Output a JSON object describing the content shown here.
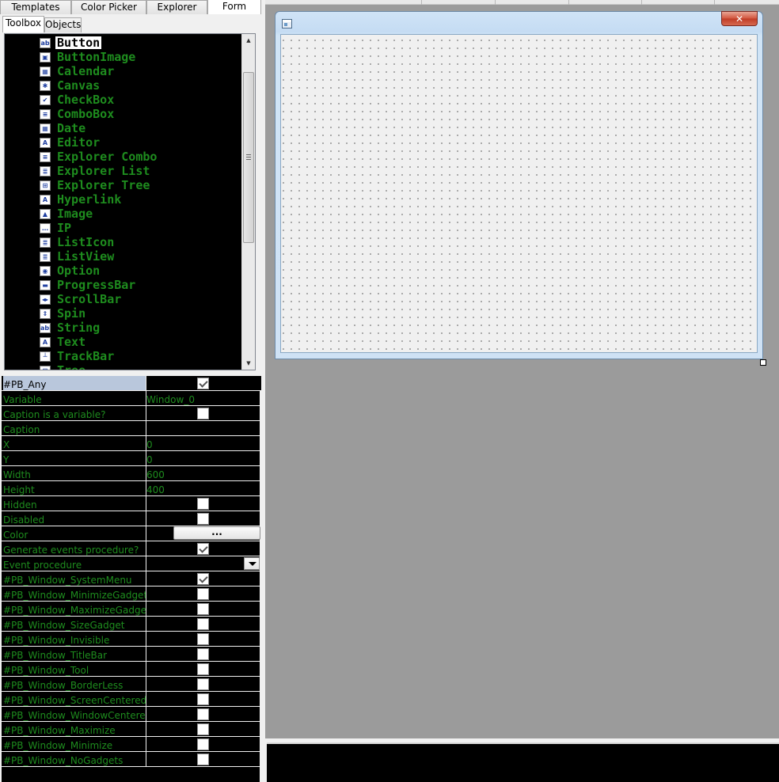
{
  "top_tabs": [
    {
      "label": "Templates",
      "active": false
    },
    {
      "label": "Color Picker",
      "active": false
    },
    {
      "label": "Explorer",
      "active": false
    },
    {
      "label": "Form",
      "active": true
    }
  ],
  "sub_tabs": [
    {
      "label": "Toolbox",
      "active": true
    },
    {
      "label": "Objects",
      "active": false
    }
  ],
  "toolbox": {
    "items": [
      {
        "label": "Button",
        "icon": "button-icon",
        "glyph": "ab",
        "selected": true
      },
      {
        "label": "ButtonImage",
        "icon": "button-image-icon",
        "glyph": "▣"
      },
      {
        "label": "Calendar",
        "icon": "calendar-icon",
        "glyph": "▦"
      },
      {
        "label": "Canvas",
        "icon": "canvas-icon",
        "glyph": "✱"
      },
      {
        "label": "CheckBox",
        "icon": "checkbox-icon",
        "glyph": "✔"
      },
      {
        "label": "ComboBox",
        "icon": "combobox-icon",
        "glyph": "≡"
      },
      {
        "label": "Date",
        "icon": "date-icon",
        "glyph": "▦"
      },
      {
        "label": "Editor",
        "icon": "editor-icon",
        "glyph": "A"
      },
      {
        "label": "Explorer Combo",
        "icon": "explorer-combo-icon",
        "glyph": "≡"
      },
      {
        "label": "Explorer List",
        "icon": "explorer-list-icon",
        "glyph": "≣"
      },
      {
        "label": "Explorer Tree",
        "icon": "explorer-tree-icon",
        "glyph": "⊞"
      },
      {
        "label": "Hyperlink",
        "icon": "hyperlink-icon",
        "glyph": "A"
      },
      {
        "label": "Image",
        "icon": "image-icon",
        "glyph": "▲"
      },
      {
        "label": "IP",
        "icon": "ip-icon",
        "glyph": "…"
      },
      {
        "label": "ListIcon",
        "icon": "list-icon-icon",
        "glyph": "≣"
      },
      {
        "label": "ListView",
        "icon": "listview-icon",
        "glyph": "≣"
      },
      {
        "label": "Option",
        "icon": "option-icon",
        "glyph": "◉"
      },
      {
        "label": "ProgressBar",
        "icon": "progressbar-icon",
        "glyph": "▬"
      },
      {
        "label": "ScrollBar",
        "icon": "scrollbar-icon",
        "glyph": "◂▸"
      },
      {
        "label": "Spin",
        "icon": "spin-icon",
        "glyph": "⇕"
      },
      {
        "label": "String",
        "icon": "string-icon",
        "glyph": "abl"
      },
      {
        "label": "Text",
        "icon": "text-icon",
        "glyph": "A"
      },
      {
        "label": "TrackBar",
        "icon": "trackbar-icon",
        "glyph": "┴"
      },
      {
        "label": "Tree",
        "icon": "tree-icon",
        "glyph": "⊞"
      }
    ]
  },
  "properties": [
    {
      "name": "#PB_Any",
      "type": "check",
      "checked": true,
      "header": true
    },
    {
      "name": "Variable",
      "type": "text",
      "value": "Window_0"
    },
    {
      "name": "Caption is a variable?",
      "type": "check",
      "checked": false
    },
    {
      "name": "Caption",
      "type": "text",
      "value": ""
    },
    {
      "name": "X",
      "type": "text",
      "value": "0"
    },
    {
      "name": "Y",
      "type": "text",
      "value": "0"
    },
    {
      "name": "Width",
      "type": "text",
      "value": "600"
    },
    {
      "name": "Height",
      "type": "text",
      "value": "400"
    },
    {
      "name": "Hidden",
      "type": "check",
      "checked": false
    },
    {
      "name": "Disabled",
      "type": "check",
      "checked": false
    },
    {
      "name": "Color",
      "type": "button",
      "value": "..."
    },
    {
      "name": "Generate events procedure?",
      "type": "check",
      "checked": true
    },
    {
      "name": "Event procedure",
      "type": "dropdown",
      "value": ""
    },
    {
      "name": "#PB_Window_SystemMenu",
      "type": "check",
      "checked": true
    },
    {
      "name": "#PB_Window_MinimizeGadget",
      "type": "check",
      "checked": false
    },
    {
      "name": "#PB_Window_MaximizeGadget",
      "type": "check",
      "checked": false
    },
    {
      "name": "#PB_Window_SizeGadget",
      "type": "check",
      "checked": false
    },
    {
      "name": "#PB_Window_Invisible",
      "type": "check",
      "checked": false
    },
    {
      "name": "#PB_Window_TitleBar",
      "type": "check",
      "checked": false
    },
    {
      "name": "#PB_Window_Tool",
      "type": "check",
      "checked": false
    },
    {
      "name": "#PB_Window_BorderLess",
      "type": "check",
      "checked": false
    },
    {
      "name": "#PB_Window_ScreenCentered",
      "type": "check",
      "checked": false
    },
    {
      "name": "#PB_Window_WindowCentered",
      "type": "check",
      "checked": false
    },
    {
      "name": "#PB_Window_Maximize",
      "type": "check",
      "checked": false
    },
    {
      "name": "#PB_Window_Minimize",
      "type": "check",
      "checked": false
    },
    {
      "name": "#PB_Window_NoGadgets",
      "type": "check",
      "checked": false
    }
  ],
  "form_window": {
    "title": "",
    "close_icon": "close-icon",
    "window_icon": "window-icon"
  },
  "colors": {
    "toolbox_bg": "#000000",
    "toolbox_text": "#1e8c1e",
    "canvas_bg": "#9b9b9b",
    "header_row": "#b9c7dc"
  }
}
